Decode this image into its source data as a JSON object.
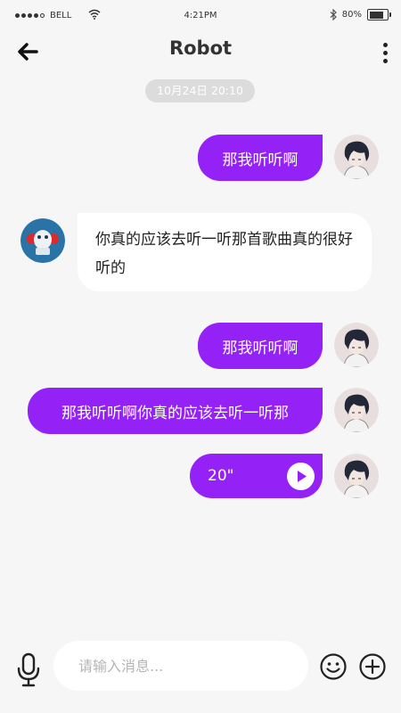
{
  "status_bar": {
    "carrier": "BELL",
    "time": "4:21PM",
    "battery": "80%",
    "battery_level": 0.8
  },
  "header": {
    "title": "Robot"
  },
  "timestamp": "10月24日 20:10",
  "messages": [
    {
      "direction": "out",
      "text": "那我听听啊"
    },
    {
      "direction": "in",
      "text": "你真的应该去听一听那首歌曲真的很好听的"
    },
    {
      "direction": "out",
      "text": "那我听听啊"
    },
    {
      "direction": "out",
      "text": "那我听听啊你真的应该去听一听那"
    },
    {
      "direction": "out",
      "type": "voice",
      "duration": "20\""
    }
  ],
  "input": {
    "placeholder": "请输入消息..."
  },
  "icons": {
    "back": "arrow-left-icon",
    "more": "more-vertical-icon",
    "mic": "microphone-icon",
    "emoji": "smiley-icon",
    "add": "plus-circle-icon",
    "play": "play-icon",
    "wifi": "wifi-icon",
    "bluetooth": "bluetooth-icon"
  },
  "colors": {
    "accent": "#9421f5",
    "background": "#f6f6f7",
    "incoming_bubble": "#ffffff"
  }
}
